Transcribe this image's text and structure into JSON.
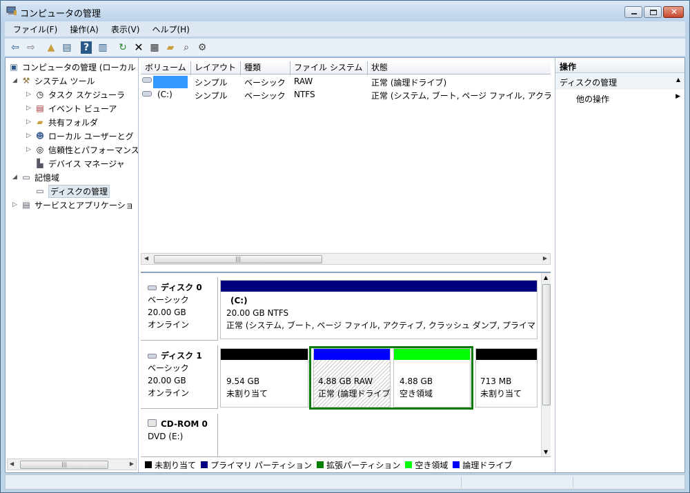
{
  "window": {
    "title": "コンピュータの管理"
  },
  "menu": [
    "ファイル(F)",
    "操作(A)",
    "表示(V)",
    "ヘルプ(H)"
  ],
  "tree": [
    {
      "label": "コンピュータの管理 (ローカル",
      "icon": "computer-icon"
    },
    {
      "label": "システム ツール",
      "icon": "tools-icon"
    },
    {
      "label": "タスク スケジューラ",
      "icon": "clock-icon"
    },
    {
      "label": "イベント ビューア",
      "icon": "event-viewer-icon"
    },
    {
      "label": "共有フォルダ",
      "icon": "shared-folder-icon"
    },
    {
      "label": "ローカル ユーザーとグ",
      "icon": "users-icon"
    },
    {
      "label": "信頼性とパフォーマンス",
      "icon": "performance-icon"
    },
    {
      "label": "デバイス マネージャ",
      "icon": "device-manager-icon"
    },
    {
      "label": "記憶域",
      "icon": "storage-icon"
    },
    {
      "label": "ディスクの管理",
      "icon": "disk-management-icon"
    },
    {
      "label": "サービスとアプリケーショ",
      "icon": "services-icon"
    }
  ],
  "volumes": {
    "columns": [
      "ボリューム",
      "レイアウト",
      "種類",
      "ファイル システム",
      "状態"
    ],
    "rows": [
      {
        "volume": "",
        "layout": "シンプル",
        "type": "ベーシック",
        "fs": "RAW",
        "status": "正常 (論理ドライブ)"
      },
      {
        "volume": "(C:)",
        "layout": "シンプル",
        "type": "ベーシック",
        "fs": "NTFS",
        "status": "正常 (システム, ブート, ページ ファイル, アクラ"
      }
    ]
  },
  "disks": [
    {
      "name": "ディスク 0",
      "kind": "ベーシック",
      "size": "20.00 GB",
      "state": "オンライン",
      "partitions": [
        {
          "title": "(C:)",
          "size": "20.00 GB NTFS",
          "status": "正常 (システム, ブート, ページ ファイル, アクティブ, クラッシュ ダンプ, プライマ",
          "bar_color": "#00007f"
        }
      ]
    },
    {
      "name": "ディスク 1",
      "kind": "ベーシック",
      "size": "20.00 GB",
      "state": "オンライン",
      "partitions": [
        {
          "size": "9.54 GB",
          "status": "未割り当て",
          "bar_color": "#000000"
        },
        {
          "size": "4.88 GB RAW",
          "status": "正常 (論理ドライブ)",
          "bar_color": "#0000ff"
        },
        {
          "size": "4.88 GB",
          "status": "空き領域",
          "bar_color": "#00ff00"
        },
        {
          "size": "713 MB",
          "status": "未割り当て",
          "bar_color": "#000000"
        }
      ]
    },
    {
      "name": "CD-ROM 0",
      "kind": "DVD (E:)"
    }
  ],
  "legend": [
    {
      "label": "未割り当て",
      "color": "#000000"
    },
    {
      "label": "プライマリ パーティション",
      "color": "#00007f"
    },
    {
      "label": "拡張パーティション",
      "color": "#007f00"
    },
    {
      "label": "空き領域",
      "color": "#00ff00"
    },
    {
      "label": "論理ドライブ",
      "color": "#0000ff"
    }
  ],
  "actions": {
    "title": "操作",
    "section": "ディスクの管理",
    "item": "他の操作"
  }
}
